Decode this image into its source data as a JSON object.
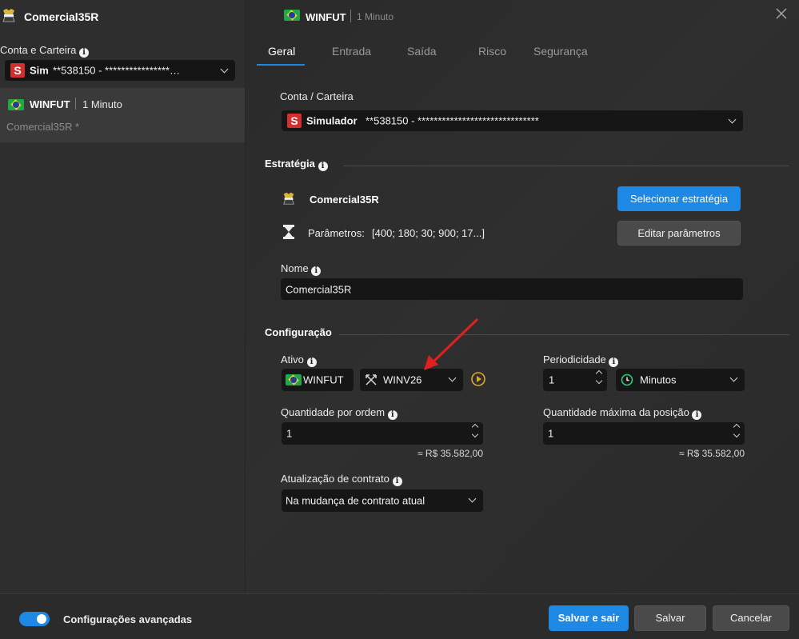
{
  "sidebar": {
    "strategy_name": "Comercial35R",
    "account_label": "Conta e Carteira",
    "account_prefix": "Sim",
    "account_value": "**538150 - ****************…",
    "item": {
      "asset": "WINFUT",
      "period": "1 Minuto",
      "strategy": "Comercial35R *"
    }
  },
  "header": {
    "asset": "WINFUT",
    "period": "1 Minuto"
  },
  "tabs": [
    {
      "label": "Geral",
      "active": true
    },
    {
      "label": "Entrada",
      "active": false
    },
    {
      "label": "Saída",
      "active": false
    },
    {
      "label": "Risco",
      "active": false
    },
    {
      "label": "Segurança",
      "active": false
    }
  ],
  "account": {
    "label": "Conta / Carteira",
    "prefix": "Simulador",
    "value": "**538150 - ******************************"
  },
  "strategy_section": {
    "title": "Estratégia",
    "name": "Comercial35R",
    "params_label": "Parâmetros:",
    "params_value": "[400; 180; 30; 900; 17...]",
    "select_button": "Selecionar estratégia",
    "edit_button": "Editar parâmetros",
    "name_label": "Nome",
    "name_value": "Comercial35R"
  },
  "config_section": {
    "title": "Configuração",
    "ativo_label": "Ativo",
    "ativo_asset": "WINFUT",
    "ativo_contract": "WINV26",
    "periodicidade_label": "Periodicidade",
    "periodicidade_value": "1",
    "periodicidade_unit": "Minutos",
    "qty_label": "Quantidade por ordem",
    "qty_value": "1",
    "qty_estimate": "≈ R$ 35.582,00",
    "max_qty_label": "Quantidade máxima da posição",
    "max_qty_value": "1",
    "max_qty_estimate": "≈ R$ 35.582,00",
    "contract_update_label": "Atualização de contrato",
    "contract_update_value": "Na mudança de contrato atual"
  },
  "footer": {
    "advanced_label": "Configurações avançadas",
    "advanced_on": true,
    "save_exit": "Salvar e sair",
    "save": "Salvar",
    "cancel": "Cancelar"
  },
  "colors": {
    "accent": "#1e88e5",
    "sim_badge": "#d32f2f",
    "arrow": "#e02020"
  }
}
